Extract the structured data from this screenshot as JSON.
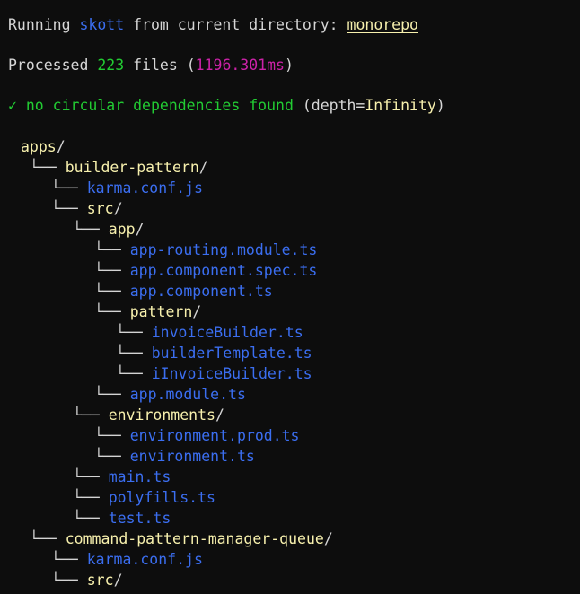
{
  "terminal": {
    "background_color": "#0d0d0d",
    "colors": {
      "file_blue": "#3b6ef0",
      "directory_yellow": "#f7f0ad",
      "success_green": "#22cc33",
      "timing_magenta": "#cc22a8",
      "default_white": "#d6d6d6",
      "connector_gray": "#d3d3d3"
    }
  },
  "header": {
    "line1": {
      "prefix": "Running ",
      "tool_name": "skott",
      "middle": " from current directory: ",
      "directory": "monorepo"
    },
    "line2": {
      "prefix": "Processed ",
      "file_count": "223",
      "middle": " files (",
      "duration": "1196.301ms",
      "suffix": ")"
    },
    "line3": {
      "check_icon": "✓",
      "message": " no circular dependencies found ",
      "depth_open": "(depth=",
      "depth_value": "Infinity",
      "depth_close": ")"
    }
  },
  "tree": {
    "connector": "└── ",
    "rows": [
      {
        "depth": 0,
        "name": "apps",
        "type": "dir",
        "connector": false
      },
      {
        "depth": 1,
        "name": "builder-pattern",
        "type": "dir",
        "connector": true
      },
      {
        "depth": 2,
        "name": "karma.conf.js",
        "type": "file",
        "connector": true
      },
      {
        "depth": 2,
        "name": "src",
        "type": "dir",
        "connector": true
      },
      {
        "depth": 3,
        "name": "app",
        "type": "dir",
        "connector": true
      },
      {
        "depth": 4,
        "name": "app-routing.module.ts",
        "type": "file",
        "connector": true
      },
      {
        "depth": 4,
        "name": "app.component.spec.ts",
        "type": "file",
        "connector": true
      },
      {
        "depth": 4,
        "name": "app.component.ts",
        "type": "file",
        "connector": true
      },
      {
        "depth": 4,
        "name": "pattern",
        "type": "dir",
        "connector": true
      },
      {
        "depth": 5,
        "name": "invoiceBuilder.ts",
        "type": "file",
        "connector": true
      },
      {
        "depth": 5,
        "name": "builderTemplate.ts",
        "type": "file",
        "connector": true
      },
      {
        "depth": 5,
        "name": "iInvoiceBuilder.ts",
        "type": "file",
        "connector": true
      },
      {
        "depth": 4,
        "name": "app.module.ts",
        "type": "file",
        "connector": true
      },
      {
        "depth": 3,
        "name": "environments",
        "type": "dir",
        "connector": true
      },
      {
        "depth": 4,
        "name": "environment.prod.ts",
        "type": "file",
        "connector": true
      },
      {
        "depth": 4,
        "name": "environment.ts",
        "type": "file",
        "connector": true
      },
      {
        "depth": 3,
        "name": "main.ts",
        "type": "file",
        "connector": true
      },
      {
        "depth": 3,
        "name": "polyfills.ts",
        "type": "file",
        "connector": true
      },
      {
        "depth": 3,
        "name": "test.ts",
        "type": "file",
        "connector": true
      },
      {
        "depth": 1,
        "name": "command-pattern-manager-queue",
        "type": "dir",
        "connector": true
      },
      {
        "depth": 2,
        "name": "karma.conf.js",
        "type": "file",
        "connector": true
      },
      {
        "depth": 2,
        "name": "src",
        "type": "dir",
        "connector": true
      }
    ]
  }
}
